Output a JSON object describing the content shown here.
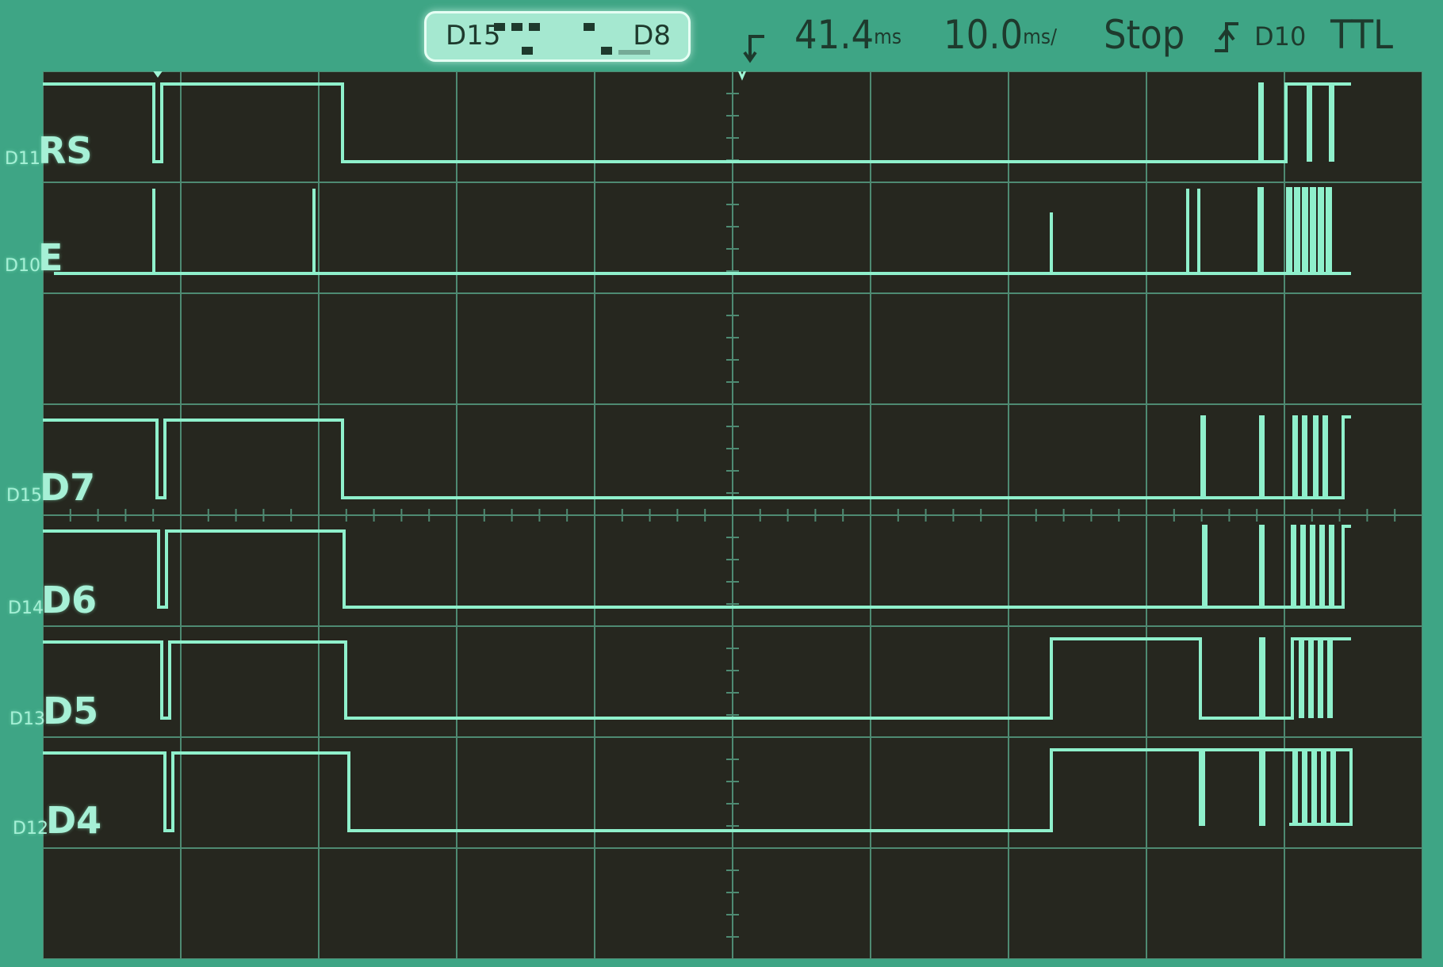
{
  "status_bar": {
    "pod_left_label": "D15",
    "pod_right_label": "D8",
    "delay": "41.4",
    "delay_unit": "ms",
    "timebase": "10.0",
    "timebase_unit": "ms/",
    "run_state": "Stop",
    "trigger_source": "D10",
    "threshold": "TTL"
  },
  "colors": {
    "bezel": "#3ea585",
    "screen": "#26271f",
    "trace": "#8ff0cc",
    "grid": "#4e8a72",
    "text_dark": "#1e3a2d"
  },
  "channels": [
    {
      "pod": "D11",
      "name": "RS"
    },
    {
      "pod": "D10",
      "name": "E"
    },
    {
      "pod": "D15",
      "name": "D7"
    },
    {
      "pod": "D14",
      "name": "D6"
    },
    {
      "pod": "D13",
      "name": "D5"
    },
    {
      "pod": "D12",
      "name": "D4"
    }
  ]
}
